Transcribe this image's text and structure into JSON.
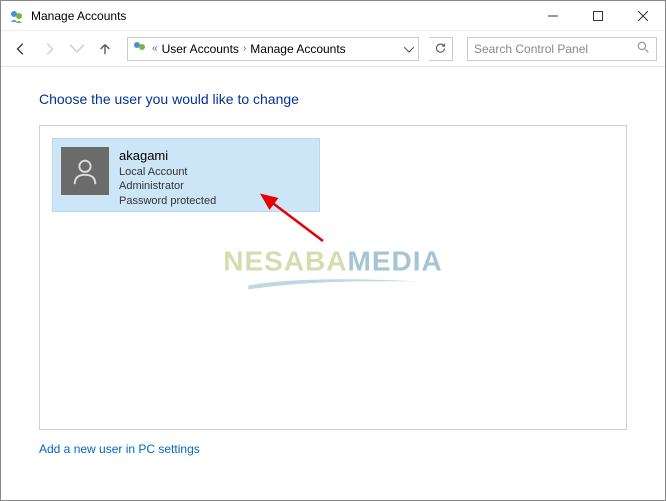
{
  "window": {
    "title": "Manage Accounts"
  },
  "breadcrumb": {
    "item1": "User Accounts",
    "item2": "Manage Accounts"
  },
  "search": {
    "placeholder": "Search Control Panel"
  },
  "page": {
    "heading": "Choose the user you would like to change",
    "add_user_link": "Add a new user in PC settings"
  },
  "account": {
    "name": "akagami",
    "type": "Local Account",
    "role": "Administrator",
    "protection": "Password protected"
  },
  "watermark": {
    "part1": "NESABA",
    "part2": "MEDIA"
  }
}
